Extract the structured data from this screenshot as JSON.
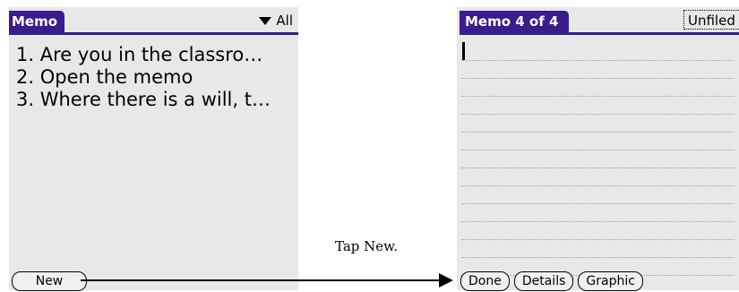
{
  "left_screen": {
    "title": "Memo",
    "category": "All",
    "memos": [
      "1. Are you in the classro…",
      "2. Open the memo",
      "3. Where there is a will, t…"
    ],
    "new_button": "New"
  },
  "annotation": {
    "caption": "Tap New."
  },
  "right_screen": {
    "title": "Memo 4 of 4",
    "category": "Unfiled",
    "buttons": {
      "done": "Done",
      "details": "Details",
      "graphic": "Graphic"
    },
    "line_count": 13
  },
  "colors": {
    "title_bar": "#3a1c8c",
    "screen_background": "#e8e8e8"
  }
}
